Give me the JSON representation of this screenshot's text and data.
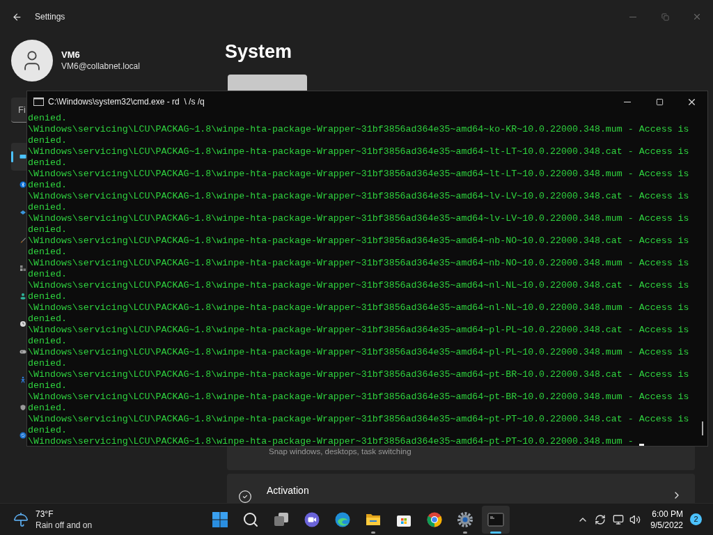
{
  "settings": {
    "title": "Settings",
    "user": {
      "name": "VM6",
      "email": "VM6@collabnet.local"
    },
    "search": {
      "placeholder": "Fi"
    },
    "nav": [
      {
        "kind": "system",
        "selected": true
      },
      {
        "kind": "bluetooth",
        "selected": false
      },
      {
        "kind": "network",
        "selected": false
      },
      {
        "kind": "personalization",
        "selected": false
      },
      {
        "kind": "apps",
        "selected": false
      },
      {
        "kind": "accounts",
        "selected": false
      },
      {
        "kind": "time",
        "selected": false
      },
      {
        "kind": "gaming",
        "selected": false
      },
      {
        "kind": "accessibility",
        "selected": false
      },
      {
        "kind": "privacy",
        "selected": false
      },
      {
        "kind": "update",
        "selected": false
      }
    ],
    "page": {
      "title": "System",
      "cards": [
        {
          "kind": "multitasking",
          "subtitle": "Snap windows, desktops, task switching"
        },
        {
          "kind": "activation",
          "title": "Activation"
        }
      ]
    }
  },
  "console": {
    "title": "C:\\Windows\\system32\\cmd.exe - rd  \\ /s /q",
    "lines": [
      "denied.",
      "\\Windows\\servicing\\LCU\\PACKAG~1.8\\winpe-hta-package-Wrapper~31bf3856ad364e35~amd64~ko-KR~10.0.22000.348.mum - Access is",
      "denied.",
      "\\Windows\\servicing\\LCU\\PACKAG~1.8\\winpe-hta-package-Wrapper~31bf3856ad364e35~amd64~lt-LT~10.0.22000.348.cat - Access is",
      "denied.",
      "\\Windows\\servicing\\LCU\\PACKAG~1.8\\winpe-hta-package-Wrapper~31bf3856ad364e35~amd64~lt-LT~10.0.22000.348.mum - Access is",
      "denied.",
      "\\Windows\\servicing\\LCU\\PACKAG~1.8\\winpe-hta-package-Wrapper~31bf3856ad364e35~amd64~lv-LV~10.0.22000.348.cat - Access is",
      "denied.",
      "\\Windows\\servicing\\LCU\\PACKAG~1.8\\winpe-hta-package-Wrapper~31bf3856ad364e35~amd64~lv-LV~10.0.22000.348.mum - Access is",
      "denied.",
      "\\Windows\\servicing\\LCU\\PACKAG~1.8\\winpe-hta-package-Wrapper~31bf3856ad364e35~amd64~nb-NO~10.0.22000.348.cat - Access is",
      "denied.",
      "\\Windows\\servicing\\LCU\\PACKAG~1.8\\winpe-hta-package-Wrapper~31bf3856ad364e35~amd64~nb-NO~10.0.22000.348.mum - Access is",
      "denied.",
      "\\Windows\\servicing\\LCU\\PACKAG~1.8\\winpe-hta-package-Wrapper~31bf3856ad364e35~amd64~nl-NL~10.0.22000.348.cat - Access is",
      "denied.",
      "\\Windows\\servicing\\LCU\\PACKAG~1.8\\winpe-hta-package-Wrapper~31bf3856ad364e35~amd64~nl-NL~10.0.22000.348.mum - Access is",
      "denied.",
      "\\Windows\\servicing\\LCU\\PACKAG~1.8\\winpe-hta-package-Wrapper~31bf3856ad364e35~amd64~pl-PL~10.0.22000.348.cat - Access is",
      "denied.",
      "\\Windows\\servicing\\LCU\\PACKAG~1.8\\winpe-hta-package-Wrapper~31bf3856ad364e35~amd64~pl-PL~10.0.22000.348.mum - Access is",
      "denied.",
      "\\Windows\\servicing\\LCU\\PACKAG~1.8\\winpe-hta-package-Wrapper~31bf3856ad364e35~amd64~pt-BR~10.0.22000.348.cat - Access is",
      "denied.",
      "\\Windows\\servicing\\LCU\\PACKAG~1.8\\winpe-hta-package-Wrapper~31bf3856ad364e35~amd64~pt-BR~10.0.22000.348.mum - Access is",
      "denied.",
      "\\Windows\\servicing\\LCU\\PACKAG~1.8\\winpe-hta-package-Wrapper~31bf3856ad364e35~amd64~pt-PT~10.0.22000.348.cat - Access is",
      "denied.",
      "\\Windows\\servicing\\LCU\\PACKAG~1.8\\winpe-hta-package-Wrapper~31bf3856ad364e35~amd64~pt-PT~10.0.22000.348.mum -"
    ]
  },
  "taskbar": {
    "weather": {
      "temp": "73°F",
      "condition": "Rain off and on"
    },
    "apps": [
      {
        "kind": "start",
        "running": false,
        "active": false
      },
      {
        "kind": "search",
        "running": false,
        "active": false
      },
      {
        "kind": "taskview",
        "running": false,
        "active": false
      },
      {
        "kind": "chat",
        "running": false,
        "active": false
      },
      {
        "kind": "edge",
        "running": false,
        "active": false
      },
      {
        "kind": "explorer",
        "running": true,
        "active": false
      },
      {
        "kind": "store",
        "running": false,
        "active": false
      },
      {
        "kind": "chrome",
        "running": false,
        "active": false
      },
      {
        "kind": "settings",
        "running": true,
        "active": false
      },
      {
        "kind": "terminal",
        "running": true,
        "active": true
      }
    ],
    "clock": {
      "time": "6:00 PM",
      "date": "9/5/2022"
    },
    "notifications": "2"
  }
}
